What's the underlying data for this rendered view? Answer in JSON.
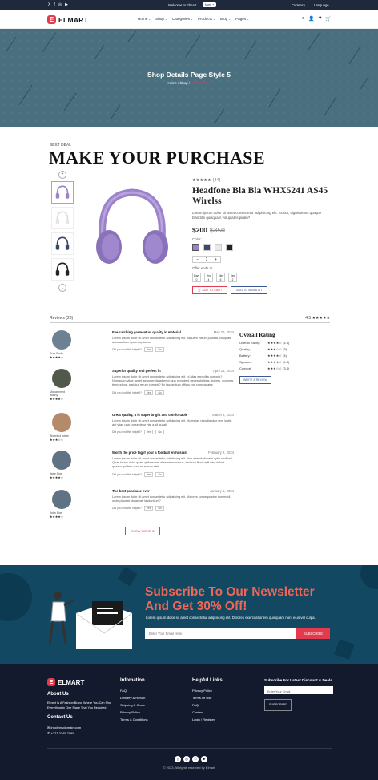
{
  "topbar": {
    "social_icons": [
      "X",
      "f",
      "◎",
      "▶"
    ],
    "welcome": "Welcome to Elmart",
    "promo": "More +",
    "currency": "Currency ⌄",
    "language": "Language ⌄"
  },
  "brand": {
    "logo_letter": "E",
    "name": "ELMART"
  },
  "menu": [
    "Home",
    "Shop",
    "Categories",
    "Products",
    "Blog",
    "Pages"
  ],
  "nav_icons": {
    "search": "⌕",
    "user": "👤",
    "wishlist": "♥",
    "cart": "🛒"
  },
  "hero": {
    "title": "Shop Details Page Style 5",
    "breadcrumb_home": "Home",
    "breadcrumb_shop": "Shop",
    "breadcrumb_current": "Shop Details"
  },
  "section": {
    "kicker": "BEST DEAL",
    "title": "MAKE YOUR PURCHASE"
  },
  "gallery": {
    "up_arrow": "⌃",
    "down_arrow": "⌄"
  },
  "product": {
    "stars": "★★★★★",
    "review_count": "(84)",
    "title": "Headfone Bla Bla WHX5241 AS45 Wirelss",
    "description": "Lorem ipsum dolor sit amet consectetur adipisicing elit. Sciuta, dignissimos quaque blanditis quisquam voluptates pirato?",
    "price": "$200",
    "old_price": "$350",
    "color_label": "Color:",
    "colors": [
      "#9b82c9",
      "#3a4a66",
      "#e8e8e8",
      "#222222"
    ],
    "qty_minus": "−",
    "qty_value": "1",
    "qty_plus": "+",
    "offer_label": "Offer ends in:",
    "timer": [
      {
        "unit": "Days",
        "value": "0"
      },
      {
        "unit": "Hrs",
        "value": "4"
      },
      {
        "unit": "Min",
        "value": "6"
      },
      {
        "unit": "Sec",
        "value": "2"
      }
    ],
    "add_to_cart": "🛒 ADD TO CART",
    "wishlist": "ADD TO WISHLIST"
  },
  "reviews": {
    "header": "Reviews (23)",
    "avg_text": "4.5 ★★★★★",
    "items": [
      {
        "name": "Sum Body",
        "stars": "★★★★☆",
        "title": "Eye catching garment w/ quality in material",
        "date": "May 20, 2024",
        "body": "Lorem ipsum dolor sit amet consectetur adipisicing elit. Aliquam earum placeat, voluptate accusantium quas explicabo!",
        "helpful": "Did you find this helpful?",
        "yes": "Yes",
        "no": "No"
      },
      {
        "name": "Mohammed Bonny",
        "stars": "★★★★☆",
        "title": "Superior quality and perfect fit",
        "date": "April 14, 2024",
        "body": "Lorem ipsum dolor sit amet consectetur adipisicing elit. Id alias expedita corporis? Numquam vitae, amet assumenda ad enim quo provident necessitatibus dolores, ducimus temporibus, pariatur rerum corrupti? Ex laudantium officia eos consequatur.",
        "helpful": "Did you find this helpful?",
        "yes": "Yes",
        "no": "No"
      },
      {
        "name": "Shomirul Islam",
        "stars": "★★★☆☆",
        "title": "Great quality, it is super bright and comfortable",
        "date": "March 8, 2024",
        "body": "Lorem ipsum dolor sit amet consectetur adipisicing elit. Molestias repudiandae rem iustis, aut vitae una consectetur nisi a sit quasi!",
        "helpful": "Did you find this helpful?",
        "yes": "Yes",
        "no": "No"
      },
      {
        "name": "Jane Doe",
        "stars": "★★★★☆",
        "title": "Worth the price tag if your a football enthusiast",
        "date": "February 2, 2024",
        "body": "Lorem ipsum dolor sit amet consectetur adipisicing elit. Non exercitationem optio molitiae! Quas totam dolor quasi quibusdam alias nemo minus, incidunt illum velit sed dolore quaero quidem cum ad earum nisi!",
        "helpful": "Did you find this helpful?",
        "yes": "Yes",
        "no": "No"
      },
      {
        "name": "John Doe",
        "stars": "★★★★☆",
        "title": "The best purchase ever",
        "date": "January 5, 2024",
        "body": "Lorem ipsum dolor sit amet consectetur adipisicing elit. Maiores consequuntur commodi unde placeat obcaecati laudantium?",
        "helpful": "Did you find this helpful?",
        "yes": "Yes",
        "no": "No"
      }
    ],
    "show_more": "SHOW MORE ⊕"
  },
  "overall": {
    "title": "Overall Rating",
    "rows": [
      {
        "k": "Overall Rating:",
        "s": "★★★★☆",
        "v": "(4.5)"
      },
      {
        "k": "Quality:",
        "s": "★★★☆☆",
        "v": "(3)"
      },
      {
        "k": "Battery:",
        "s": "★★★★☆",
        "v": "(4)"
      },
      {
        "k": "Speaker:",
        "s": "★★★★☆",
        "v": "(4.5)"
      },
      {
        "k": "Comfort:",
        "s": "★★★☆☆",
        "v": "(3.5)"
      }
    ],
    "write": "WRITE A REVIEW"
  },
  "newsletter": {
    "headline_1": "Subscribe To Our Newsletter",
    "headline_2": "And Get 30% Off!",
    "description": "Lorem ipsum dolor sit amet consectetur adipisicing elit. Dolores exercitationem quisquam non, eius vel culpa.",
    "placeholder": "Enter Your Email Here",
    "button": "SUBSCRIBE"
  },
  "footer": {
    "about_title": "About Us",
    "about_text": "Elmart Is A Fashion Brand Where You Can Find Everything In One Place That You Required",
    "contact_title": "Contact Us",
    "email": "info@mydomain.com",
    "phone": "+777 2345 7885",
    "info_title": "Infomation",
    "info_links": [
      "FAQ",
      "Delivery & Return",
      "Shipping & Costs",
      "Privacy Policy",
      "Terms & Conditions"
    ],
    "help_title": "Helpful Links",
    "help_links": [
      "Privacy Policy",
      "Terms Of Use",
      "FAQ",
      "Contact",
      "Login / Register"
    ],
    "sub_title": "Subscribe For Latest Discount & Deals",
    "sub_placeholder": "Enter Your Email",
    "sub_button": "SUBSCRIBE",
    "social": [
      "f",
      "◎",
      "✆",
      "▶"
    ],
    "copyright": "© 2023, All rights reserved by Elmart"
  }
}
